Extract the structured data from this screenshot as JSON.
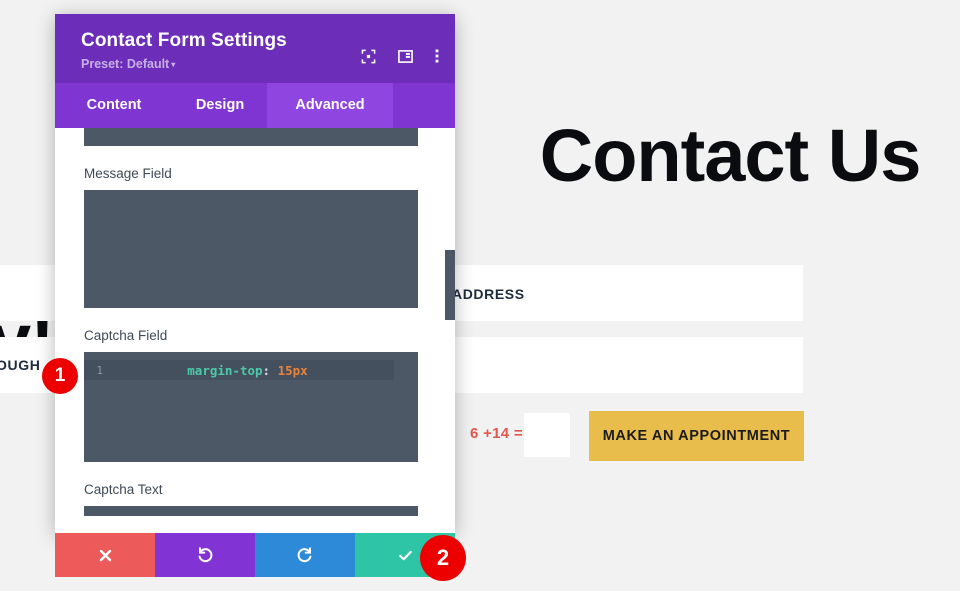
{
  "background": {
    "hero_line1": "ke                    Contact Us",
    "hero_line2": "y!",
    "address_label": "ADDRESS",
    "rough_label": "OUGH",
    "captcha_sum": "6 +14 =",
    "captcha_input_value": "",
    "appointment_button": "MAKE AN APPOINTMENT",
    "page_bg_color": "#f2f2f2",
    "panel_color": "#ffffff",
    "button_color": "#e9bd4c",
    "captcha_text_color": "#e2574c"
  },
  "modal": {
    "title": "Contact Form Settings",
    "preset_label": "Preset: Default",
    "preset_caret": "▾",
    "header_color": "#6c2eb9",
    "tabbar_color": "#7f35d1",
    "active_tab_color": "#8f45e0",
    "header_icons": [
      {
        "name": "focus-icon"
      },
      {
        "name": "layout-panel-icon"
      },
      {
        "name": "more-vertical-icon"
      }
    ],
    "tabs": [
      {
        "label": "Content",
        "active": false
      },
      {
        "label": "Design",
        "active": false
      },
      {
        "label": "Advanced",
        "active": true
      }
    ],
    "fields": [
      {
        "label": "Message Field",
        "code_lines": []
      },
      {
        "label": "Captcha Field",
        "code_lines": [
          {
            "number": "1",
            "property": "margin-top",
            "punctuation": ":",
            "value": " 15px"
          }
        ]
      },
      {
        "label": "Captcha Text",
        "code_lines": []
      }
    ],
    "code_bg_color": "#4c5866",
    "code_line_bg_color": "#44505e",
    "token_colors": {
      "property": "#4ec9a8",
      "punctuation": "#d6dde4",
      "value": "#e8833a",
      "gutter": "#8d99a6"
    },
    "actions": [
      {
        "name": "cancel-button",
        "icon": "close-icon",
        "color": "#ed5a5a"
      },
      {
        "name": "undo-button",
        "icon": "undo-icon",
        "color": "#8133d4"
      },
      {
        "name": "redo-button",
        "icon": "redo-icon",
        "color": "#2d8ad8"
      },
      {
        "name": "save-button",
        "icon": "check-icon",
        "color": "#2ec4a6"
      }
    ]
  },
  "annotations": [
    {
      "label": "1"
    },
    {
      "label": "2"
    }
  ]
}
